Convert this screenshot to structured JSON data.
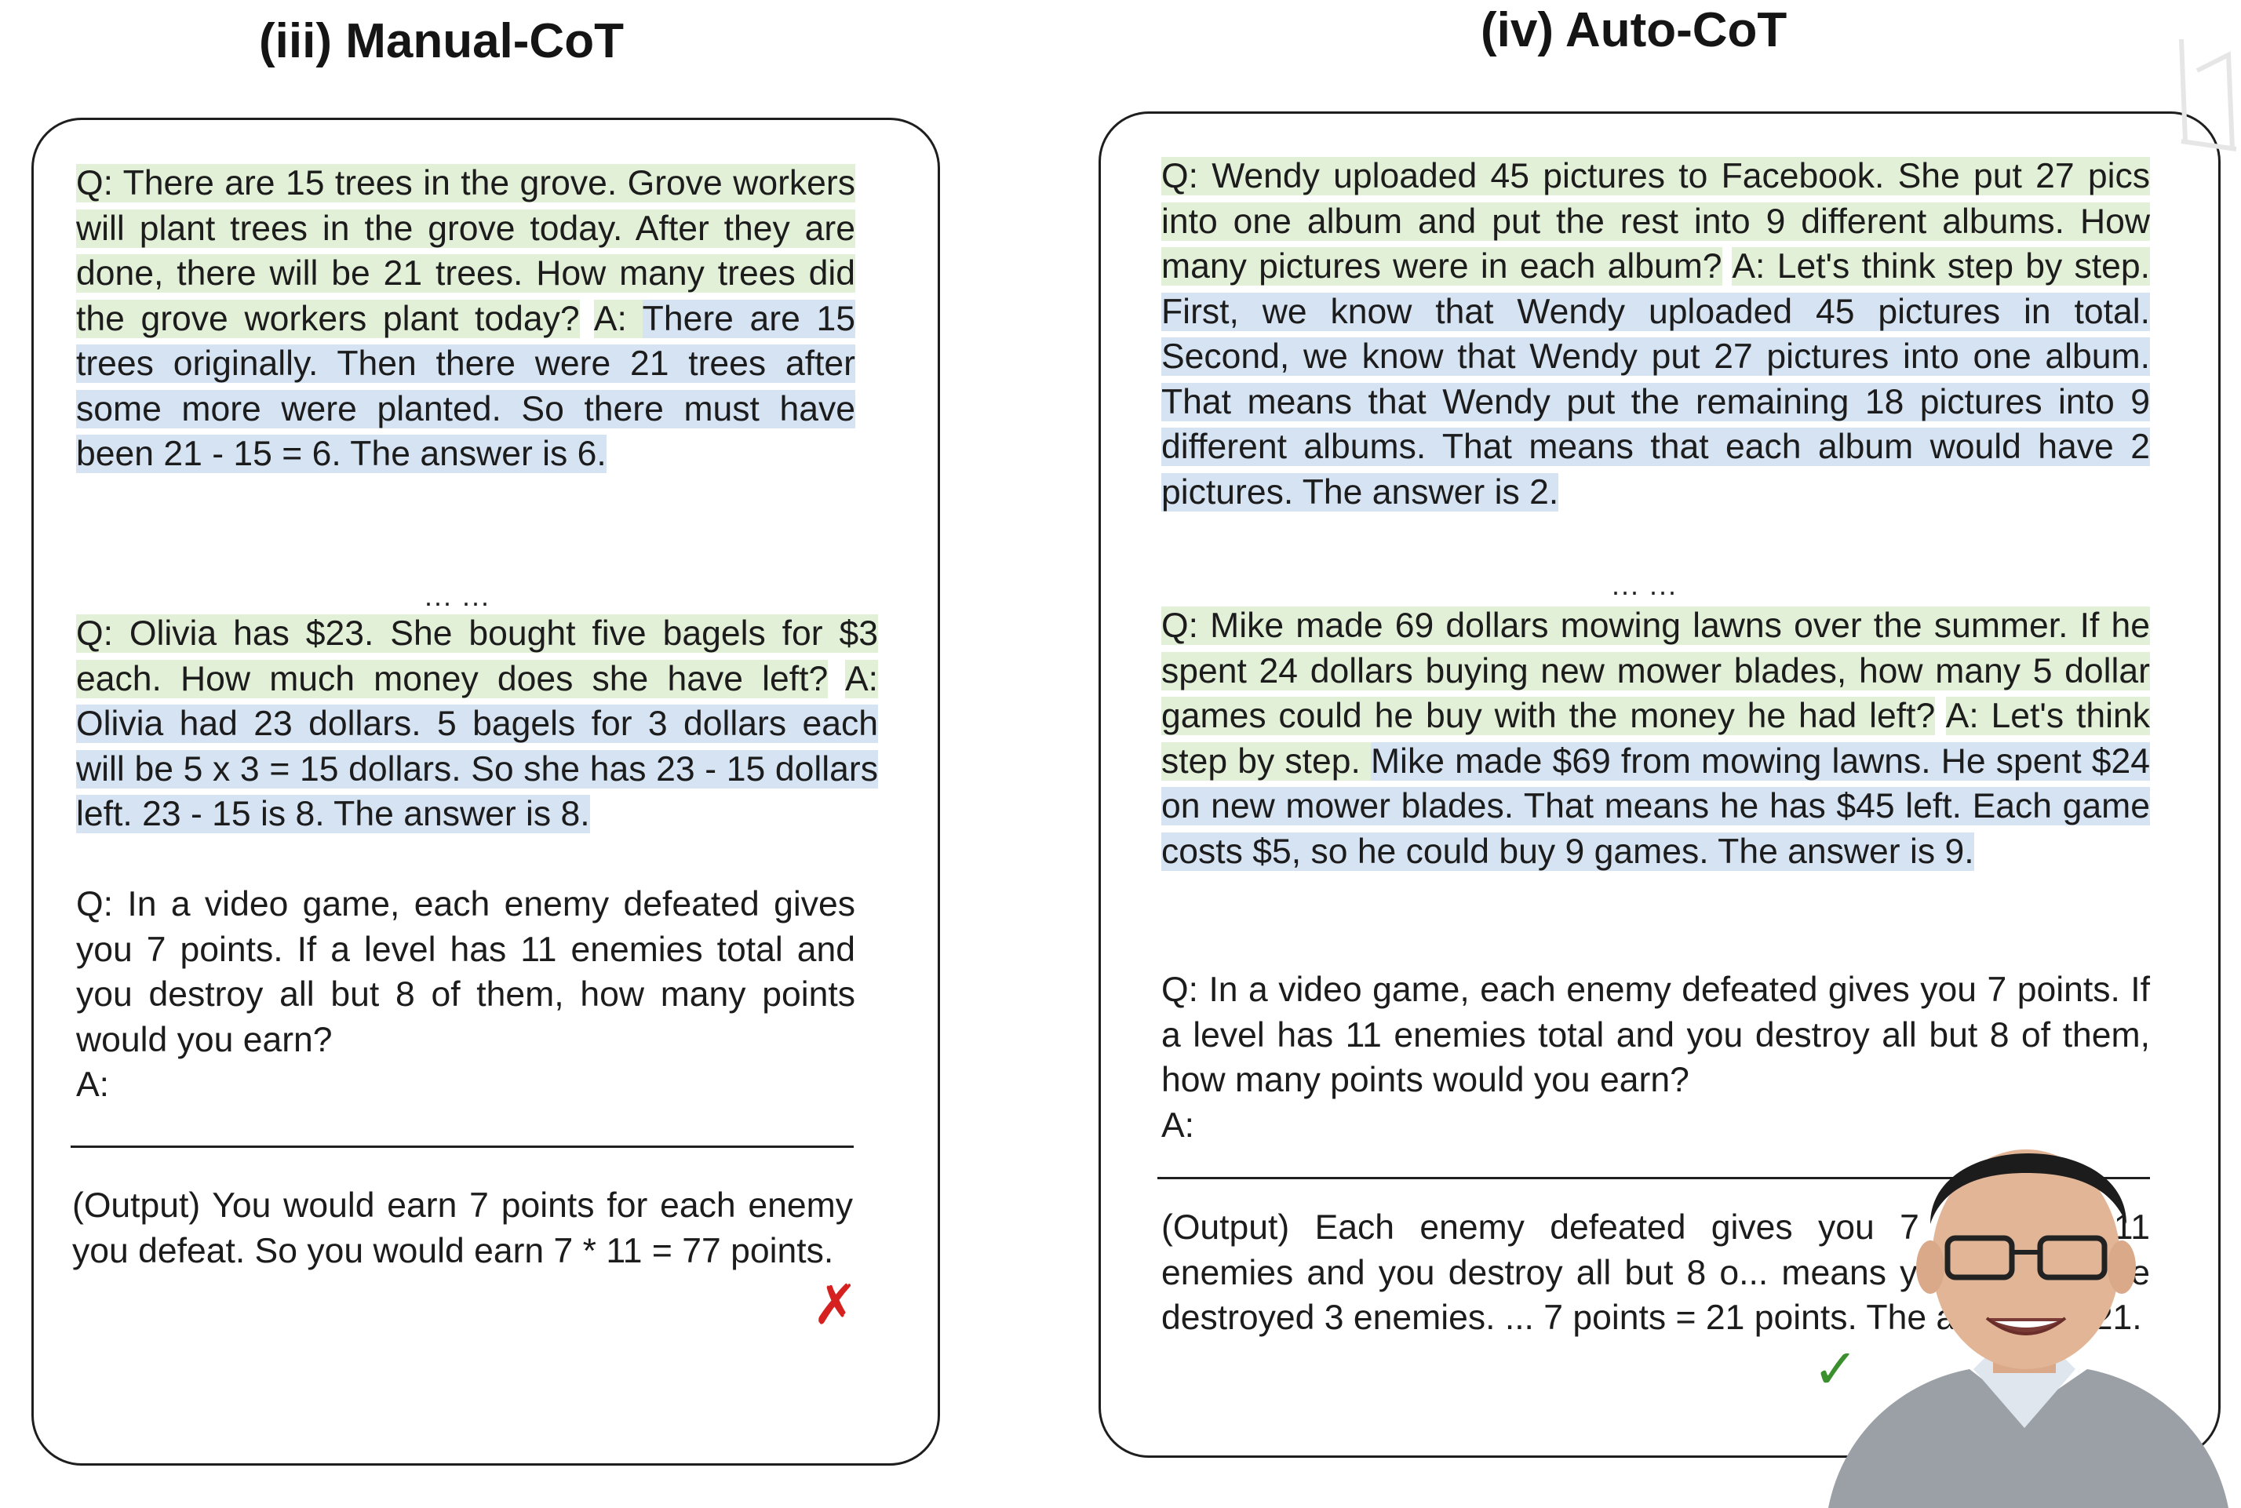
{
  "left_panel": {
    "title": "(iii) Manual-CoT",
    "example1": {
      "question": "Q: There are 15 trees in the grove. Grove workers will plant trees in the grove today. After they are done, there will be 21 trees. How many trees did the grove workers plant today?",
      "answer_prefix": "A: ",
      "answer": "There are 15 trees originally. Then there were 21 trees after some more were planted. So there must have been 21 - 15 = 6. The answer is 6."
    },
    "ellipsis": "... ...",
    "example2": {
      "question": "Q: Olivia has $23. She bought five bagels for $3 each. How much money does she have left?",
      "answer_prefix": "A: ",
      "answer": "Olivia had 23 dollars. 5 bagels for 3 dollars each will be 5 x 3 = 15 dollars. So she has 23 - 15 dollars left. 23 - 15 is 8. The answer is 8."
    },
    "test_question": "Q: In a video game, each enemy defeated gives you 7 points. If a level has 11 enemies total and you destroy all but 8 of them, how many points would you earn?",
    "test_answer_prefix": "A:",
    "output": "(Output) You would earn 7 points for each enemy you defeat. So you would earn 7 * 11 = 77 points.",
    "result_mark": "✗",
    "result_color": "#d62121"
  },
  "right_panel": {
    "title": "(iv) Auto-CoT",
    "example1": {
      "question": "Q: Wendy uploaded 45 pictures to Facebook. She put 27 pics into one album and put the rest into 9 different albums. How many pictures were in each album?",
      "answer_prefix": "A: Let's think step by step. ",
      "answer": "First, we know that Wendy uploaded 45 pictures in total. Second, we know that Wendy put 27 pictures into one album. That means that Wendy put the remaining 18 pictures into 9 different albums. That means that each album would have 2 pictures. The answer is 2."
    },
    "ellipsis": "... ...",
    "example2": {
      "question": "Q: Mike made 69 dollars mowing lawns over the summer. If he spent 24 dollars buying new mower blades, how many 5 dollar games could he buy with the money he had left?",
      "answer_prefix": "A: Let's think step by step. ",
      "answer": "Mike made $69 from mowing lawns. He spent $24 on new mower blades. That means he has $45 left. Each game costs $5, so he could buy 9 games. The answer is 9."
    },
    "test_question": "Q: In a video game, each enemy defeated gives you 7 points. If a level has 11 enemies total and you destroy all but 8 of them, how many points would you earn?",
    "test_answer_prefix": "A:",
    "output": "(Output) Each enemy defeated gives you 7 po... are 11 enemies and you destroy all but 8 o... means you would have destroyed 3 enemies. ... 7 points = 21 points. The answer is 21.",
    "result_mark": "✓",
    "result_color": "#3c8f2f"
  },
  "colors": {
    "question_highlight": "#e3f0d8",
    "answer_highlight": "#d5e3f2",
    "border": "#1e1e1e"
  }
}
